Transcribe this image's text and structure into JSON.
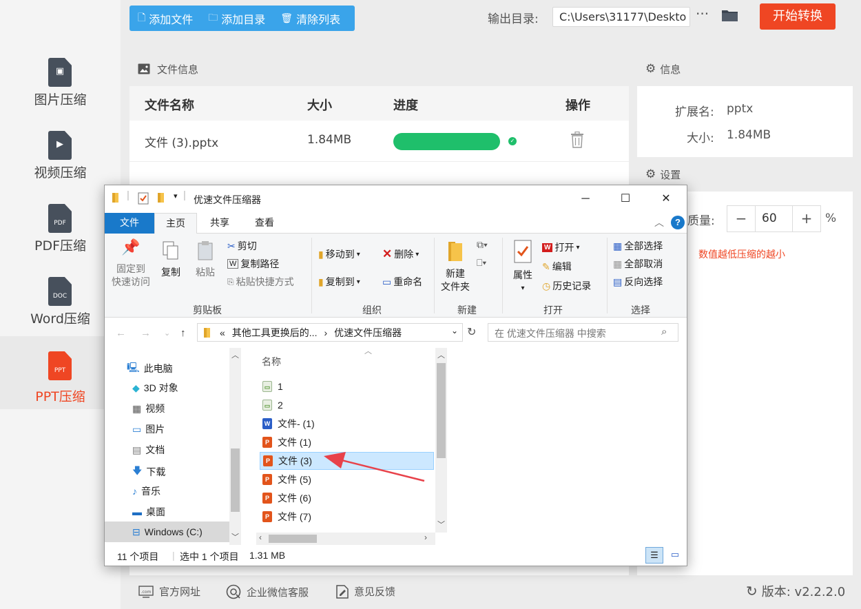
{
  "sidebar": {
    "items": [
      {
        "label": "图片压缩",
        "icon_tag": "",
        "glyph": "▣"
      },
      {
        "label": "视频压缩",
        "icon_tag": "",
        "glyph": "▶"
      },
      {
        "label": "PDF压缩",
        "icon_tag": "PDF",
        "glyph": ""
      },
      {
        "label": "Word压缩",
        "icon_tag": "DOC",
        "glyph": ""
      },
      {
        "label": "PPT压缩",
        "icon_tag": "PPT",
        "glyph": ""
      }
    ],
    "active_index": 4
  },
  "toolbar": {
    "add_file": "添加文件",
    "add_dir": "添加目录",
    "clear_list": "清除列表",
    "output_label": "输出目录:",
    "output_path": "C:\\Users\\31177\\Deskto",
    "more": "···",
    "start": "开始转换"
  },
  "file_panel": {
    "title": "文件信息",
    "columns": [
      "文件名称",
      "大小",
      "进度",
      "操作"
    ],
    "rows": [
      {
        "name": "文件 (3).pptx",
        "size": "1.84MB",
        "progress": 1.0
      }
    ]
  },
  "info_panel": {
    "info_title": "信息",
    "ext_label": "扩展名:",
    "ext_value": "pptx",
    "size_label": "大小:",
    "size_value": "1.84MB",
    "settings_title": "设置",
    "quality_label": "质量:",
    "quality_value": "60",
    "unit": "%",
    "hint": "数值越低压缩的越小"
  },
  "bottom_bar": {
    "website": "官方网址",
    "wechat": "企业微信客服",
    "feedback": "意见反馈",
    "version": "版本: v2.2.2.0"
  },
  "explorer": {
    "title": "优速文件压缩器",
    "tabs": [
      "文件",
      "主页",
      "共享",
      "查看"
    ],
    "ribbon": {
      "pin": [
        "固定到",
        "快速访问"
      ],
      "copy": "复制",
      "paste": "粘贴",
      "cut": "剪切",
      "copy_path": "复制路径",
      "paste_shortcut": "粘贴快捷方式",
      "clipboard": "剪贴板",
      "move_to": "移动到",
      "copy_to": "复制到",
      "delete": "删除",
      "rename": "重命名",
      "organize": "组织",
      "new_folder": [
        "新建",
        "文件夹"
      ],
      "new": "新建",
      "properties": "属性",
      "open": "打开",
      "edit": "编辑",
      "history": "历史记录",
      "open_group": "打开",
      "select_all": "全部选择",
      "select_none": "全部取消",
      "invert": "反向选择",
      "select_group": "选择"
    },
    "address": {
      "prefix": "«",
      "crumb1": "其他工具更换后的...",
      "sep": "›",
      "crumb2": "优速文件压缩器",
      "search_placeholder": "在 优速文件压缩器 中搜索"
    },
    "nav": [
      "此电脑",
      "3D 对象",
      "视频",
      "图片",
      "文档",
      "下载",
      "音乐",
      "桌面",
      "Windows (C:)"
    ],
    "column_name": "名称",
    "files": [
      {
        "name": "1",
        "type": "g"
      },
      {
        "name": "2",
        "type": "g"
      },
      {
        "name": "文件- (1)",
        "type": "w"
      },
      {
        "name": "文件 (1)",
        "type": "p"
      },
      {
        "name": "文件 (3)",
        "type": "p",
        "selected": true
      },
      {
        "name": "文件 (5)",
        "type": "p"
      },
      {
        "name": "文件 (6)",
        "type": "p"
      },
      {
        "name": "文件 (7)",
        "type": "p"
      }
    ],
    "status": {
      "count": "11 个项目",
      "selected": "选中 1 个项目",
      "size": "1.31 MB"
    }
  },
  "colors": {
    "accent_blue": "#3aa4ea",
    "accent_red": "#ef4623",
    "progress_green": "#1fbf6b",
    "arrow_red": "#e8424a"
  }
}
